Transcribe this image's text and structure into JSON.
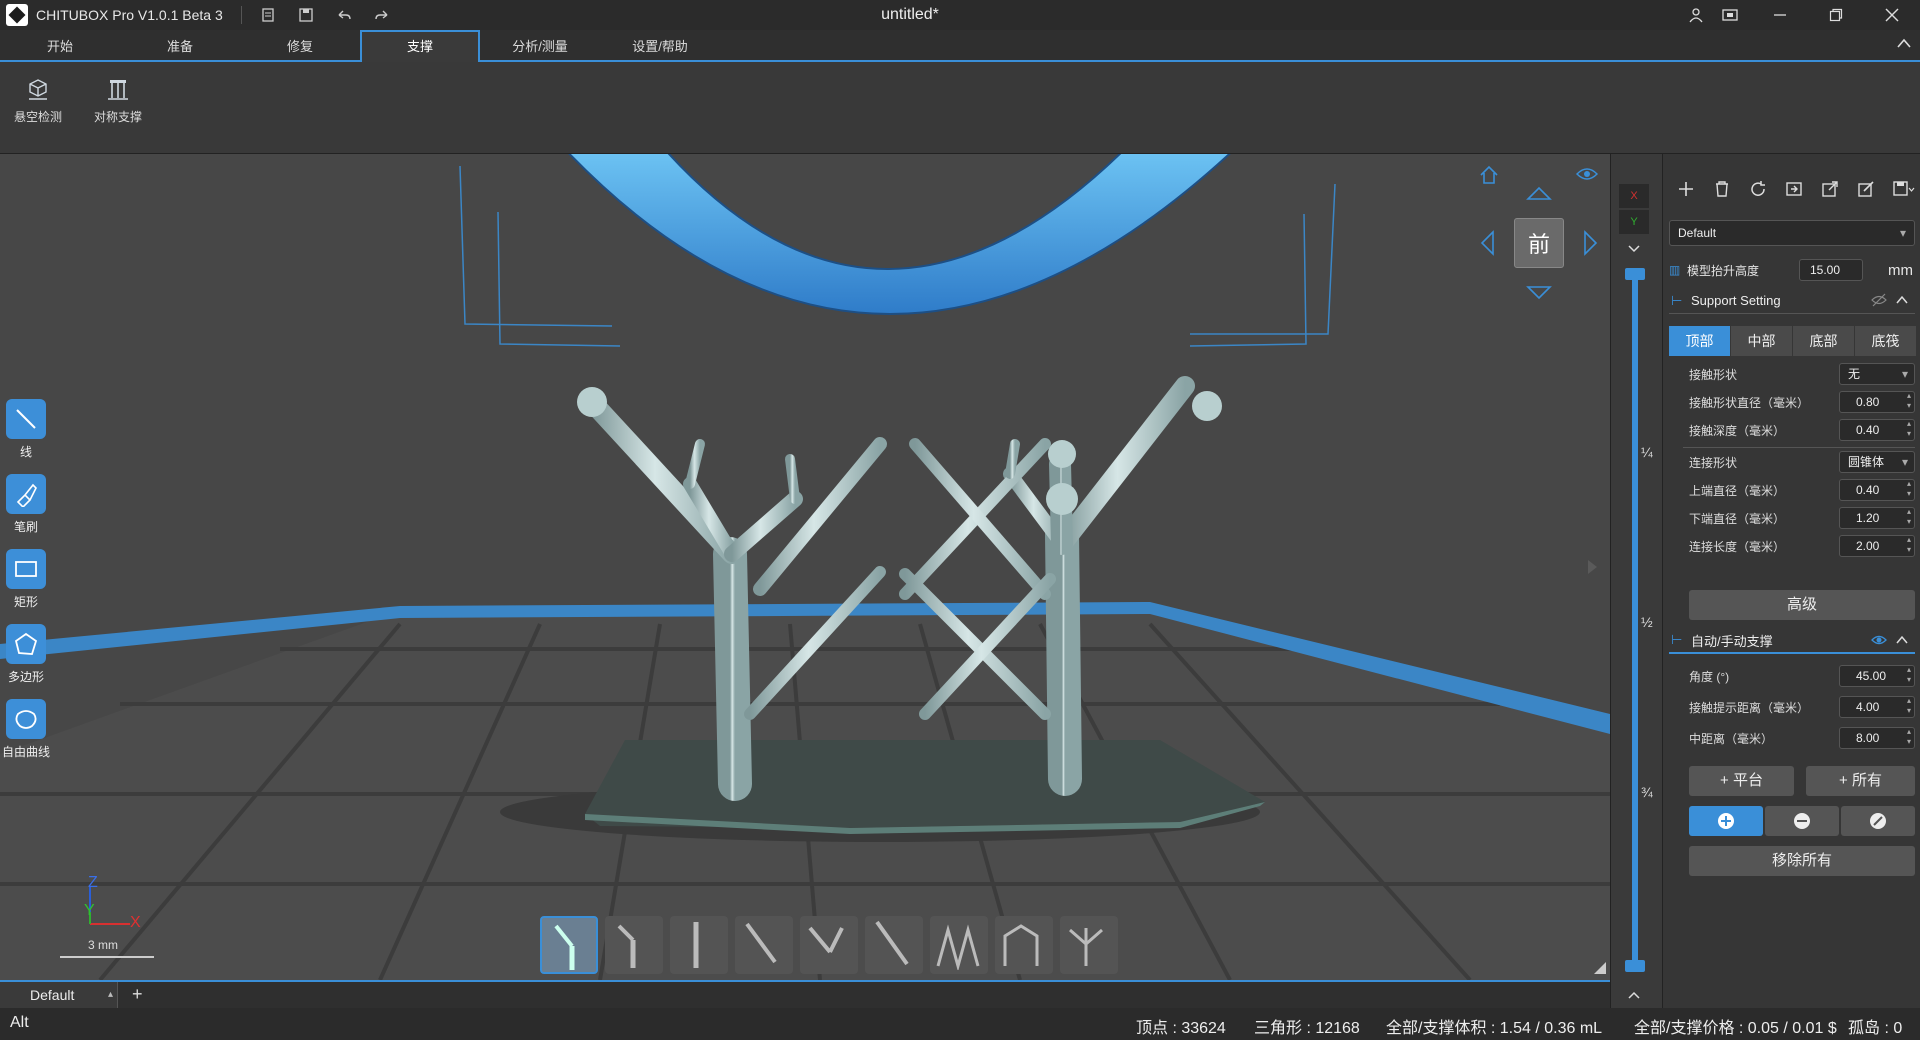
{
  "titlebar": {
    "app_name": "CHITUBOX Pro V1.0.1 Beta 3",
    "doc_title": "untitled*"
  },
  "tabs": [
    {
      "label": "开始"
    },
    {
      "label": "准备"
    },
    {
      "label": "修复"
    },
    {
      "label": "支撑",
      "active": true
    },
    {
      "label": "分析/测量"
    },
    {
      "label": "设置/帮助"
    }
  ],
  "ribbon": {
    "items": [
      {
        "label": "悬空检测",
        "icon": "cube-detect-icon"
      },
      {
        "label": "对称支撑",
        "icon": "symmetric-support-icon"
      }
    ]
  },
  "left_tools": [
    {
      "label": "线",
      "icon": "line-icon"
    },
    {
      "label": "笔刷",
      "icon": "brush-icon"
    },
    {
      "label": "矩形",
      "icon": "rectangle-icon"
    },
    {
      "label": "多边形",
      "icon": "polygon-icon"
    },
    {
      "label": "自由曲线",
      "icon": "freeform-icon"
    }
  ],
  "navcube": {
    "face_label": "前"
  },
  "axes": {
    "z": "Z",
    "y": "Y",
    "x": "X",
    "scale": "3 mm"
  },
  "layer_slider": {
    "marks": [
      "¼",
      "½",
      "¾"
    ],
    "axis_x": "X",
    "axis_y": "Y"
  },
  "panel": {
    "profile": "Default",
    "lift_label": "模型抬升高度",
    "lift_value": "15.00",
    "lift_unit": "mm",
    "support_setting_title": "Support Setting",
    "sub_tabs": [
      {
        "label": "顶部",
        "active": true
      },
      {
        "label": "中部"
      },
      {
        "label": "底部"
      },
      {
        "label": "底筏"
      }
    ],
    "top_rows": [
      {
        "label": "接触形状",
        "value": "无",
        "type": "dropdown"
      },
      {
        "label": "接触形状直径（毫米）",
        "value": "0.80",
        "type": "spin"
      },
      {
        "label": "接触深度（毫米）",
        "value": "0.40",
        "type": "spin"
      },
      {
        "label": "连接形状",
        "value": "圆锥体",
        "type": "dropdown"
      },
      {
        "label": "上端直径（毫米）",
        "value": "0.40",
        "type": "spin"
      },
      {
        "label": "下端直径（毫米）",
        "value": "1.20",
        "type": "spin"
      },
      {
        "label": "连接长度（毫米）",
        "value": "2.00",
        "type": "spin"
      }
    ],
    "advanced_label": "高级",
    "auto_title": "自动/手动支撑",
    "auto_rows": [
      {
        "label": "角度 (°)",
        "value": "45.00"
      },
      {
        "label": "接触提示距离（毫米）",
        "value": "4.00"
      },
      {
        "label": "中距离（毫米）",
        "value": "8.00"
      }
    ],
    "plus_platform": "+ 平台",
    "plus_all": "+ 所有",
    "remove_all": "移除所有"
  },
  "bottom_tab": {
    "label": "Default",
    "add": "+"
  },
  "status": {
    "left": "Alt",
    "vertices": "顶点 : 33624",
    "triangles": "三角形 : 12168",
    "volume": "全部/支撑体积 : 1.54 / 0.36 mL",
    "price": "全部/支撑价格 : 0.05 / 0.01 $",
    "islands": "孤岛 : 0"
  },
  "colors": {
    "accent": "#3a8fd8",
    "support": "#a9c3c4",
    "model": "#3b8fd6"
  }
}
